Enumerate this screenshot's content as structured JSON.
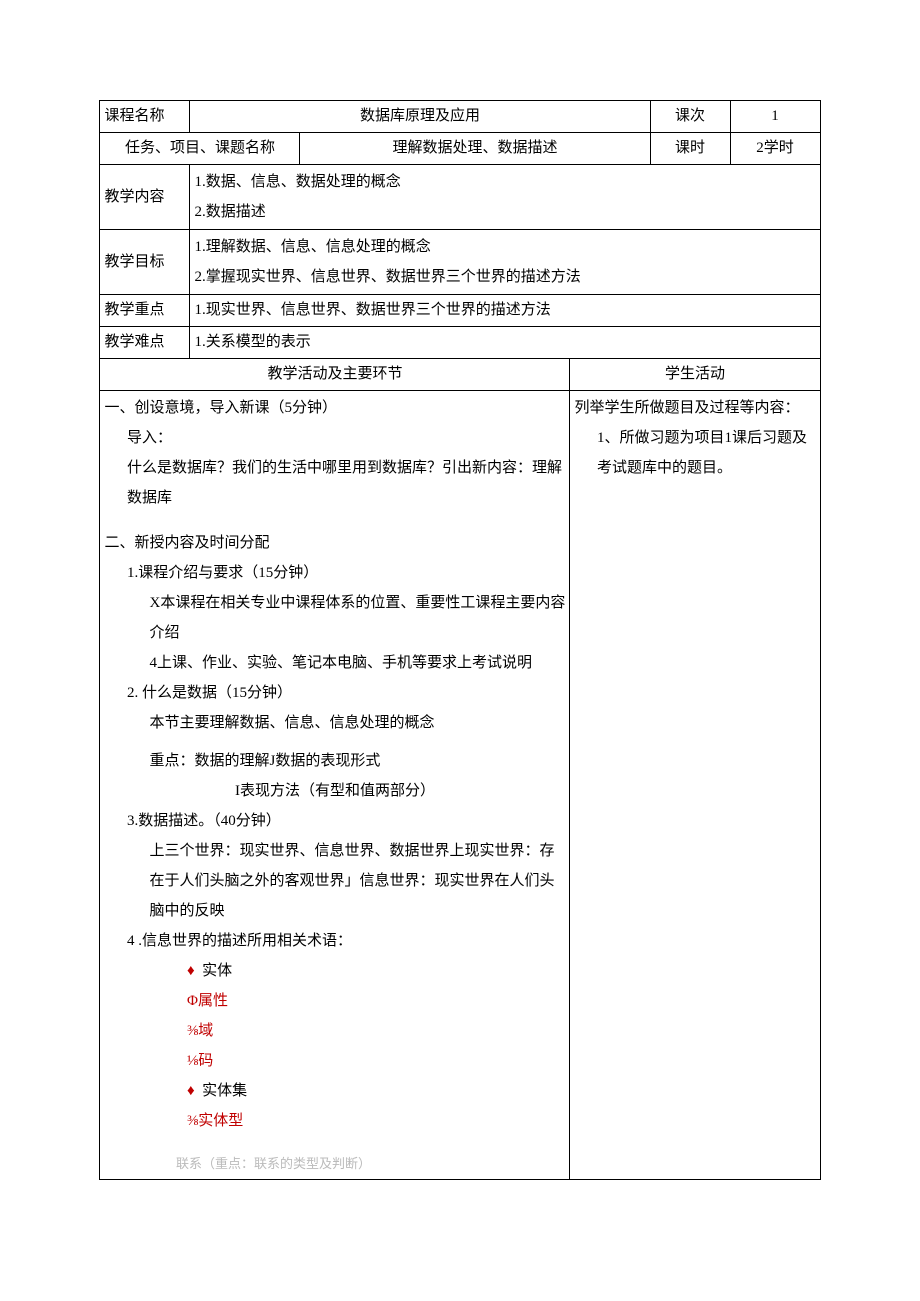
{
  "header": {
    "course_name_label": "课程名称",
    "course_name_value": "数据库原理及应用",
    "session_count_label": "课次",
    "session_count_value": "1",
    "task_label": "任务、项目、课题名称",
    "task_value": "理解数据处理、数据描述",
    "period_label": "课时",
    "period_value": "2学时"
  },
  "rows": {
    "content_label": "教学内容",
    "content_value_1": "1.数据、信息、数据处理的概念",
    "content_value_2": "2.数据描述",
    "goal_label": "教学目标",
    "goal_value_1": "1.理解数据、信息、信息处理的概念",
    "goal_value_2": "2.掌握现实世界、信息世界、数据世界三个世界的描述方法",
    "keypoint_label": "教学重点",
    "keypoint_value": "1.现实世界、信息世界、数据世界三个世界的描述方法",
    "difficulty_label": "教学难点",
    "difficulty_value": "1.关系模型的表示"
  },
  "columns": {
    "teaching_header": "教学活动及主要环节",
    "student_header": "学生活动"
  },
  "teaching": {
    "sec1_title": "一、创设意境，导入新课（5分钟）",
    "sec1_l1": "导入：",
    "sec1_l2": "什么是数据库？我们的生活中哪里用到数据库？引出新内容：理解数据库",
    "sec2_title": "二、新授内容及时间分配",
    "sec2_1_title": "1.课程介绍与要求（15分钟）",
    "sec2_1_l1": "X本课程在相关专业中课程体系的位置、重要性工课程主要内容介绍",
    "sec2_1_l2": "4上课、作业、实验、笔记本电脑、手机等要求上考试说明",
    "sec2_2_title": "2. 什么是数据（15分钟）",
    "sec2_2_l1": "本节主要理解数据、信息、信息处理的概念",
    "sec2_2_l2": "重点：数据的理解J数据的表现形式",
    "sec2_2_l3": "I表现方法（有型和值两部分）",
    "sec2_3_title": "3.数据描述。（40分钟）",
    "sec2_3_l1": "上三个世界：现实世界、信息世界、数据世界上现实世界：存在于人们头脑之外的客观世界」信息世界：现实世界在人们头脑中的反映",
    "sec2_4_title": "4 .信息世界的描述所用相关术语：",
    "b1": "实体",
    "b2": "Φ属性",
    "b3": "⅜域",
    "b4": "⅛码",
    "b5": "实体集",
    "b6": "⅜实体型",
    "cut": "联系（重点：联系的类型及判断）",
    "diamond": "♦"
  },
  "student": {
    "l1": "列举学生所做题目及过程等内容：",
    "l2": "1、所做习题为项目1课后习题及考试题库中的题目。"
  }
}
